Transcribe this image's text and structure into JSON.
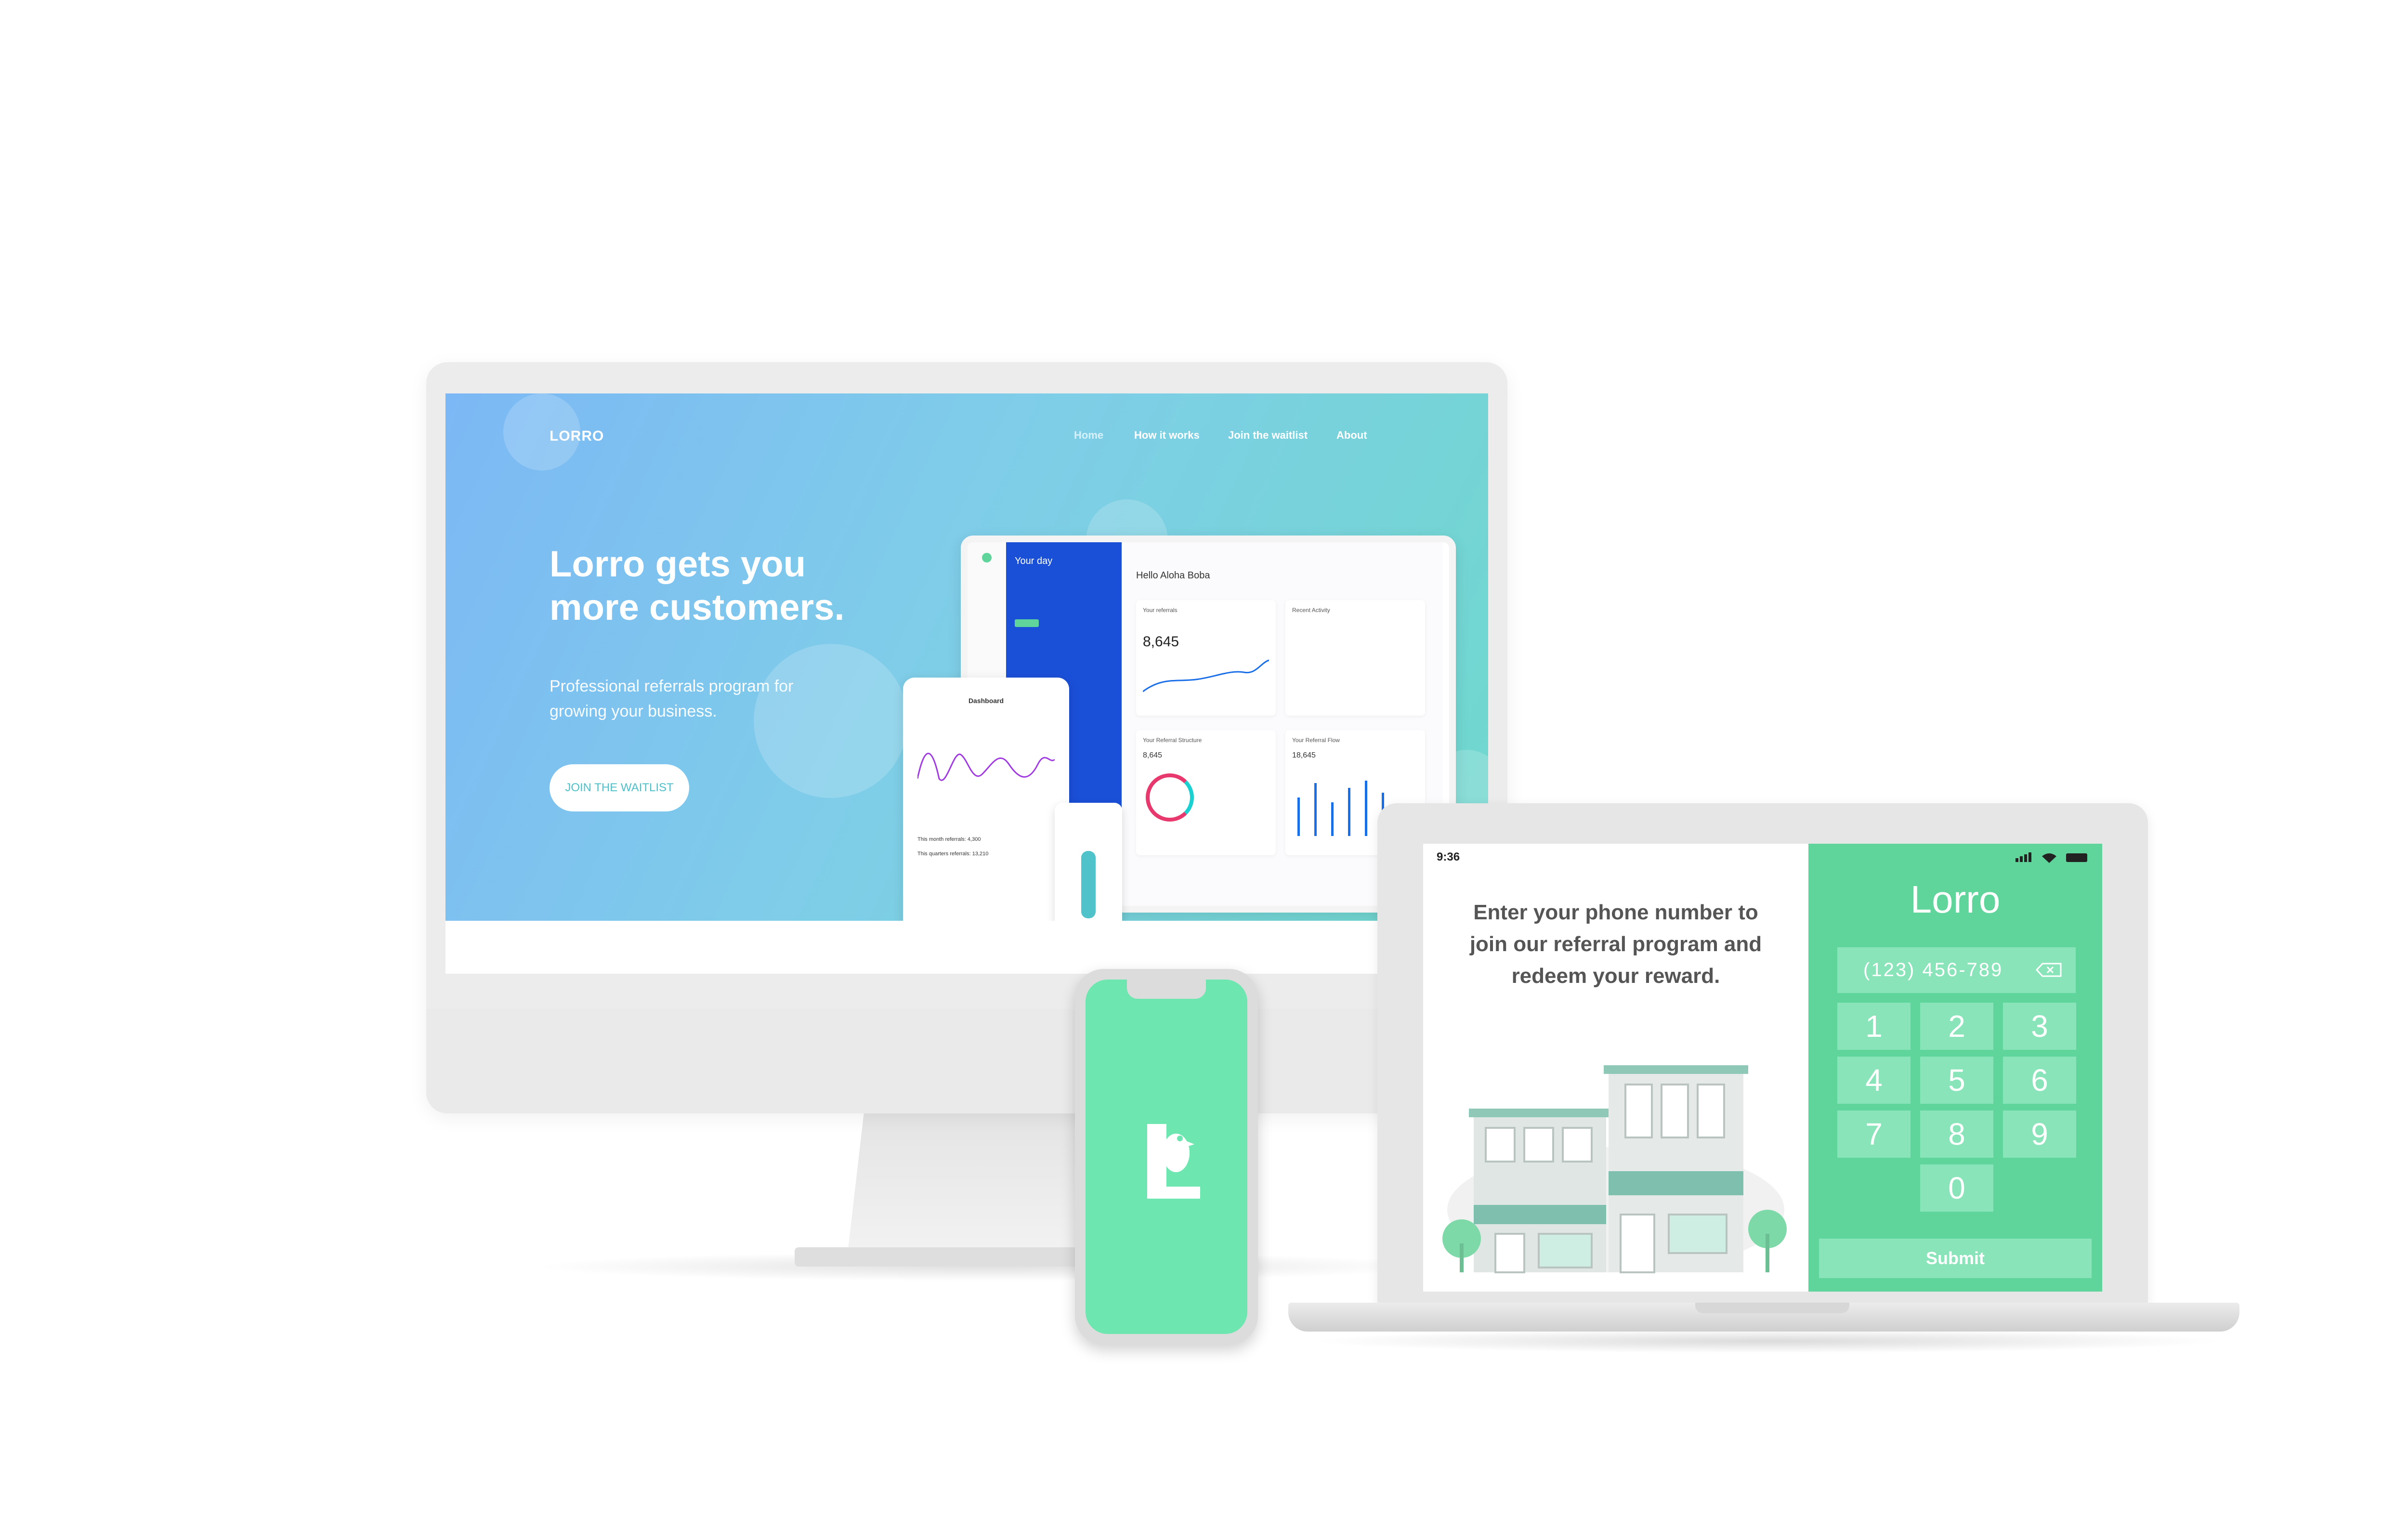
{
  "landing": {
    "brand": "LORRO",
    "nav": [
      {
        "label": "Home"
      },
      {
        "label": "How it works"
      },
      {
        "label": "Join the waitlist"
      },
      {
        "label": "About"
      }
    ],
    "headline_line1": "Lorro gets you",
    "headline_line2": "more customers.",
    "subheadline_line1": "Professional referrals program for",
    "subheadline_line2": "growing your business.",
    "cta_label": "JOIN THE WAITLIST"
  },
  "dashboard": {
    "panel_title": "Your day",
    "greeting": "Hello Aloha Boba",
    "card_referrals_label": "Your referrals",
    "card_referrals_value": "8,645",
    "card_activity_label": "Recent Activity",
    "card_structure_label": "Your Referral Structure",
    "card_structure_value": "8,645",
    "card_flow_label": "Your Referral Flow",
    "card_flow_value": "18,645"
  },
  "tablet": {
    "title": "Dashboard",
    "stat_month": "This month referrals: 4,300",
    "stat_quarter": "This quarters referrals: 13,210"
  },
  "kiosk": {
    "status_time": "9:36",
    "prompt_line1": "Enter your phone number to",
    "prompt_line2": "join our referral program and",
    "prompt_line3": "redeem your reward.",
    "brand": "Lorro",
    "phone_value": "(123) 456-789",
    "keys": [
      "1",
      "2",
      "3",
      "4",
      "5",
      "6",
      "7",
      "8",
      "9",
      "0"
    ],
    "submit_label": "Submit"
  },
  "colors": {
    "kiosk_green": "#5fd59b",
    "key_green": "#8ae4b9",
    "phone_green": "#6ee6b0",
    "hero_gradient_start": "#7cb8f5",
    "hero_gradient_end": "#6fd8cc",
    "dashboard_blue": "#1a4fd8"
  },
  "icons": {
    "backspace": "backspace-icon",
    "app_logo": "lorro-parrot-logo",
    "storefront": "storefront-illustration"
  }
}
